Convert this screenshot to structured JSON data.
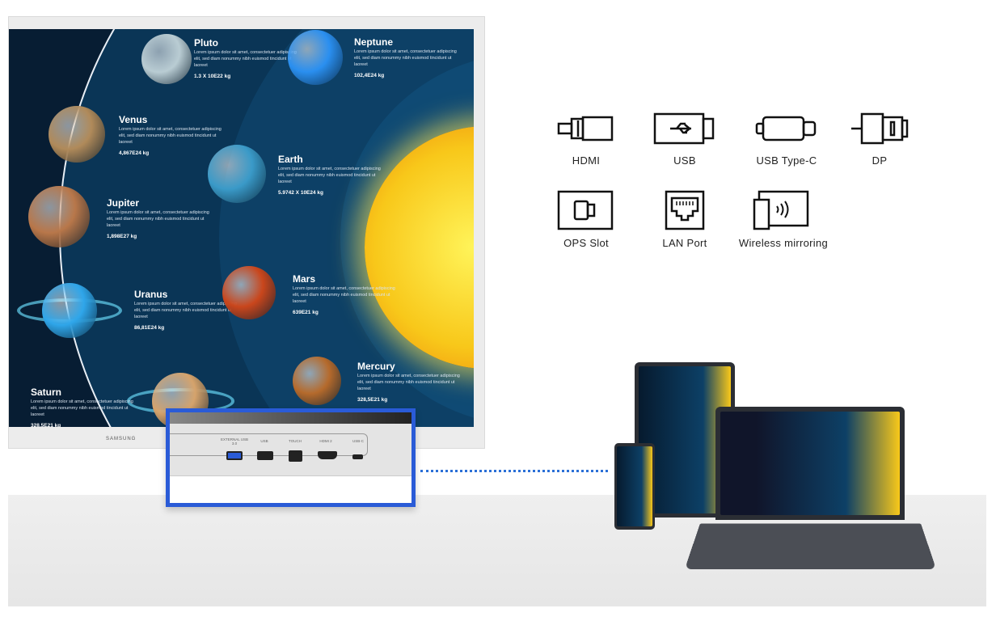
{
  "display": {
    "brand": "SAMSUNG",
    "planets": [
      {
        "name": "Pluto",
        "desc": "Lorem ipsum dolor sit amet, consectetuer adipiscing elit, sed diam nonummy nibh euismod tincidunt ut laoreet",
        "mass": "1.3 X 10E22 kg",
        "color": "#b9ccd3"
      },
      {
        "name": "Neptune",
        "desc": "Lorem ipsum dolor sit amet, consectetuer adipiscing elit, sed diam nonummy nibh euismod tincidunt ut laoreet",
        "mass": "102,4E24 kg",
        "color": "#2a8ff0"
      },
      {
        "name": "Venus",
        "desc": "Lorem ipsum dolor sit amet, consectetuer adipiscing elit, sed diam nonummy nibh euismod tincidunt ut laoreet",
        "mass": "4,867E24 kg",
        "color": "#b08a5a"
      },
      {
        "name": "Earth",
        "desc": "Lorem ipsum dolor sit amet, consectetuer adipiscing elit, sed diam nonummy nibh euismod tincidunt ut laoreet",
        "mass": "5.9742 X 10E24 kg",
        "color": "#3a9ac8"
      },
      {
        "name": "Jupiter",
        "desc": "Lorem ipsum dolor sit amet, consectetuer adipiscing elit, sed diam nonummy nibh euismod tincidunt ut laoreet",
        "mass": "1,898E27 kg",
        "color": "#b8774a"
      },
      {
        "name": "Uranus",
        "desc": "Lorem ipsum dolor sit amet, consectetuer adipiscing elit, sed diam nonummy nibh euismod tincidunt ut laoreet",
        "mass": "86,81E24 kg",
        "color": "#2fa6ea"
      },
      {
        "name": "Mars",
        "desc": "Lorem ipsum dolor sit amet, consectetuer adipiscing elit, sed diam nonummy nibh euismod tincidunt ut laoreet",
        "mass": "639E21 kg",
        "color": "#c9461c"
      },
      {
        "name": "Mercury",
        "desc": "Lorem ipsum dolor sit amet, consectetuer adipiscing elit, sed diam nonummy nibh euismod tincidunt ut laoreet",
        "mass": "328,5E21 kg",
        "color": "#b56a2c"
      },
      {
        "name": "Saturn",
        "desc": "Lorem ipsum dolor sit amet, consectetuer adipiscing elit, sed diam nonummy nibh euismod tincidunt ut laoreet",
        "mass": "328,5E21 kg",
        "color": "#d5a36c"
      }
    ]
  },
  "ports": [
    "EXTERNAL USB 3.0",
    "USB",
    "TOUCH",
    "HDMI 2",
    "USB-C"
  ],
  "accent": "#2a5bd7",
  "connectivity": [
    {
      "label": "HDMI",
      "icon": "hdmi-icon"
    },
    {
      "label": "USB",
      "icon": "usb-icon"
    },
    {
      "label": "USB Type-C",
      "icon": "usb-c-icon"
    },
    {
      "label": "DP",
      "icon": "displayport-icon"
    },
    {
      "label": "OPS Slot",
      "icon": "ops-slot-icon"
    },
    {
      "label": "LAN Port",
      "icon": "lan-port-icon"
    },
    {
      "label": "Wireless mirroring",
      "icon": "wireless-mirroring-icon"
    }
  ]
}
